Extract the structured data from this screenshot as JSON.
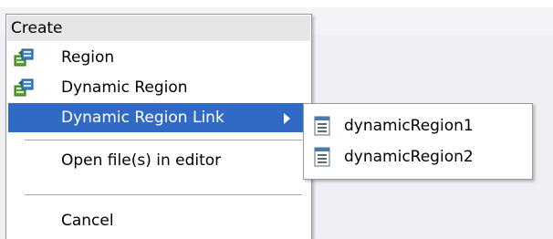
{
  "menu": {
    "header": "Create",
    "items": [
      {
        "label": "Region",
        "icon": "region-icon"
      },
      {
        "label": "Dynamic Region",
        "icon": "dynamic-region-icon"
      },
      {
        "label": "Dynamic Region Link",
        "highlighted": true,
        "has_submenu": true
      },
      {
        "label": "Open file(s) in editor"
      },
      {
        "label": "Cancel"
      }
    ]
  },
  "submenu": {
    "items": [
      {
        "label": "dynamicRegion1",
        "icon": "task-flow-icon"
      },
      {
        "label": "dynamicRegion2",
        "icon": "task-flow-icon"
      }
    ]
  },
  "colors": {
    "highlight": "#316ac5",
    "menu_header_bg": "#e6e6e6",
    "backdrop": "#eef0f6"
  }
}
